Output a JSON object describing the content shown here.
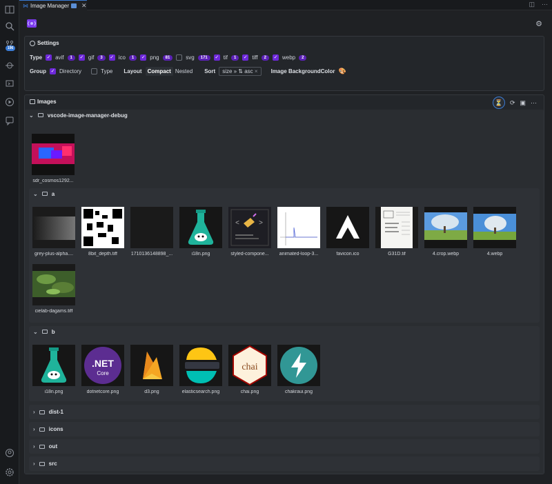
{
  "tab": {
    "title": "Image Manager",
    "close": "✕"
  },
  "activity": {
    "badge": "196"
  },
  "settings": {
    "title": "Settings",
    "type_label": "Type",
    "types": [
      {
        "ext": "avif",
        "count": "1",
        "checked": true
      },
      {
        "ext": "gif",
        "count": "3",
        "checked": true
      },
      {
        "ext": "ico",
        "count": "1",
        "checked": true
      },
      {
        "ext": "png",
        "count": "81",
        "checked": true
      },
      {
        "ext": "svg",
        "count": "171",
        "checked": false
      },
      {
        "ext": "tif",
        "count": "1",
        "checked": true
      },
      {
        "ext": "tiff",
        "count": "2",
        "checked": true
      },
      {
        "ext": "webp",
        "count": "2",
        "checked": true
      }
    ],
    "group_label": "Group",
    "group_directory": "Directory",
    "group_type": "Type",
    "layout_label": "Layout",
    "layout_compact": "Compact",
    "layout_nested": "Nested",
    "sort_label": "Sort",
    "sort_value": "size » ⇅ asc",
    "bgcolor_label": "Image BackgroundColor"
  },
  "images": {
    "title": "Images",
    "root_folder": "vscode-image-manager-debug",
    "root_files": [
      "sdr_cosmos1292..."
    ],
    "folder_a": "a",
    "a_files": [
      "grey-plus-alpha....",
      "8bit_depth.tiff",
      "1710136148898_...",
      "i18n.png",
      "styled-compone...",
      "animated-loop-3...",
      "favicon.ico",
      "G31D.tif",
      "4.crop.webp",
      "4.webp",
      "cielab-dagams.tiff"
    ],
    "folder_b": "b",
    "b_files": [
      "i18n.png",
      "dotnetcore.png",
      "d3.png",
      "elasticsearch.png",
      "chai.png",
      "chakraui.png"
    ],
    "collapsed_folders": [
      "dist-1",
      "icons",
      "out",
      "src"
    ]
  },
  "thumb_text": {
    "net": ".NET",
    "core": "Core",
    "chai": "chai"
  },
  "colors": {
    "accent": "#6d28d9",
    "focus": "#3a7bd5"
  }
}
